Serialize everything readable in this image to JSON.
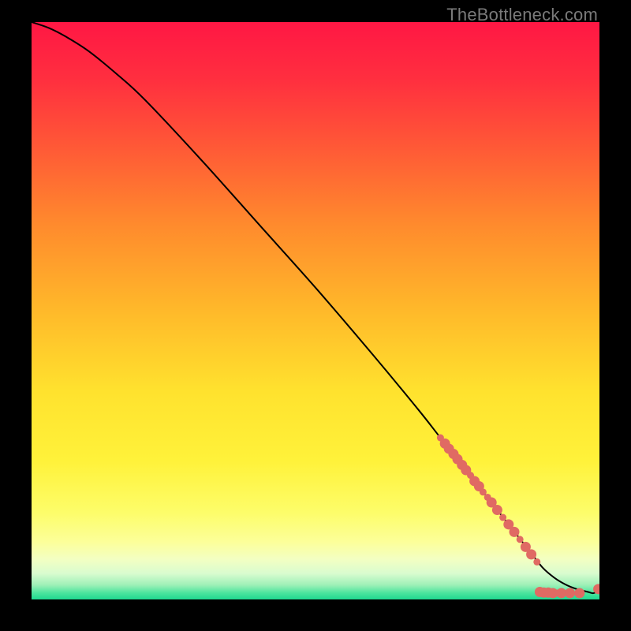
{
  "watermark": "TheBottleneck.com",
  "chart_data": {
    "type": "line",
    "title": "",
    "xlabel": "",
    "ylabel": "",
    "xlim": [
      0,
      100
    ],
    "ylim": [
      0,
      100
    ],
    "grid": false,
    "legend": false,
    "series": [
      {
        "name": "curve",
        "x": [
          0,
          3,
          6,
          10,
          15,
          20,
          30,
          40,
          50,
          60,
          68,
          72,
          76,
          80,
          84,
          88,
          90,
          92,
          94,
          96,
          98,
          99,
          100
        ],
        "y": [
          100,
          99,
          97.5,
          95,
          91,
          86.5,
          76,
          65,
          54,
          42.5,
          33,
          28,
          23,
          18,
          13,
          8,
          5.5,
          3.8,
          2.6,
          1.8,
          1.3,
          1.1,
          1.8
        ],
        "color": "#000000"
      }
    ],
    "markers": {
      "name": "highlight-points",
      "color": "#e06a63",
      "radius_small": 4.5,
      "radius_large": 6.5,
      "points": [
        {
          "x": 72.0,
          "y": 28.0,
          "r": "s"
        },
        {
          "x": 72.8,
          "y": 27.0,
          "r": "l"
        },
        {
          "x": 73.5,
          "y": 26.1,
          "r": "l"
        },
        {
          "x": 74.3,
          "y": 25.2,
          "r": "l"
        },
        {
          "x": 75.0,
          "y": 24.3,
          "r": "l"
        },
        {
          "x": 75.8,
          "y": 23.3,
          "r": "l"
        },
        {
          "x": 76.5,
          "y": 22.4,
          "r": "l"
        },
        {
          "x": 77.3,
          "y": 21.5,
          "r": "s"
        },
        {
          "x": 78.0,
          "y": 20.5,
          "r": "l"
        },
        {
          "x": 78.8,
          "y": 19.6,
          "r": "l"
        },
        {
          "x": 79.5,
          "y": 18.6,
          "r": "s"
        },
        {
          "x": 80.3,
          "y": 17.7,
          "r": "s"
        },
        {
          "x": 81.0,
          "y": 16.8,
          "r": "l"
        },
        {
          "x": 82.0,
          "y": 15.5,
          "r": "l"
        },
        {
          "x": 83.0,
          "y": 14.2,
          "r": "s"
        },
        {
          "x": 84.0,
          "y": 13.0,
          "r": "l"
        },
        {
          "x": 85.0,
          "y": 11.7,
          "r": "l"
        },
        {
          "x": 86.0,
          "y": 10.4,
          "r": "s"
        },
        {
          "x": 87.0,
          "y": 9.1,
          "r": "l"
        },
        {
          "x": 88.0,
          "y": 7.8,
          "r": "l"
        },
        {
          "x": 89.0,
          "y": 6.5,
          "r": "s"
        },
        {
          "x": 89.5,
          "y": 1.3,
          "r": "l"
        },
        {
          "x": 90.2,
          "y": 1.2,
          "r": "l"
        },
        {
          "x": 91.0,
          "y": 1.2,
          "r": "l"
        },
        {
          "x": 91.8,
          "y": 1.1,
          "r": "l"
        },
        {
          "x": 92.5,
          "y": 1.1,
          "r": "s"
        },
        {
          "x": 93.3,
          "y": 1.1,
          "r": "l"
        },
        {
          "x": 94.8,
          "y": 1.1,
          "r": "l"
        },
        {
          "x": 96.5,
          "y": 1.1,
          "r": "l"
        },
        {
          "x": 99.8,
          "y": 1.8,
          "r": "l"
        }
      ]
    },
    "gradient_stops": [
      {
        "offset": 0.0,
        "color": "#ff1744"
      },
      {
        "offset": 0.1,
        "color": "#ff2f3f"
      },
      {
        "offset": 0.22,
        "color": "#ff5a36"
      },
      {
        "offset": 0.35,
        "color": "#ff8a2d"
      },
      {
        "offset": 0.5,
        "color": "#ffb92a"
      },
      {
        "offset": 0.64,
        "color": "#ffe22e"
      },
      {
        "offset": 0.76,
        "color": "#fff23a"
      },
      {
        "offset": 0.85,
        "color": "#fdfd6a"
      },
      {
        "offset": 0.9,
        "color": "#fcff99"
      },
      {
        "offset": 0.93,
        "color": "#f3ffc2"
      },
      {
        "offset": 0.955,
        "color": "#d9fccf"
      },
      {
        "offset": 0.975,
        "color": "#9ef0b7"
      },
      {
        "offset": 0.988,
        "color": "#4fe59f"
      },
      {
        "offset": 1.0,
        "color": "#1fd88f"
      }
    ]
  }
}
